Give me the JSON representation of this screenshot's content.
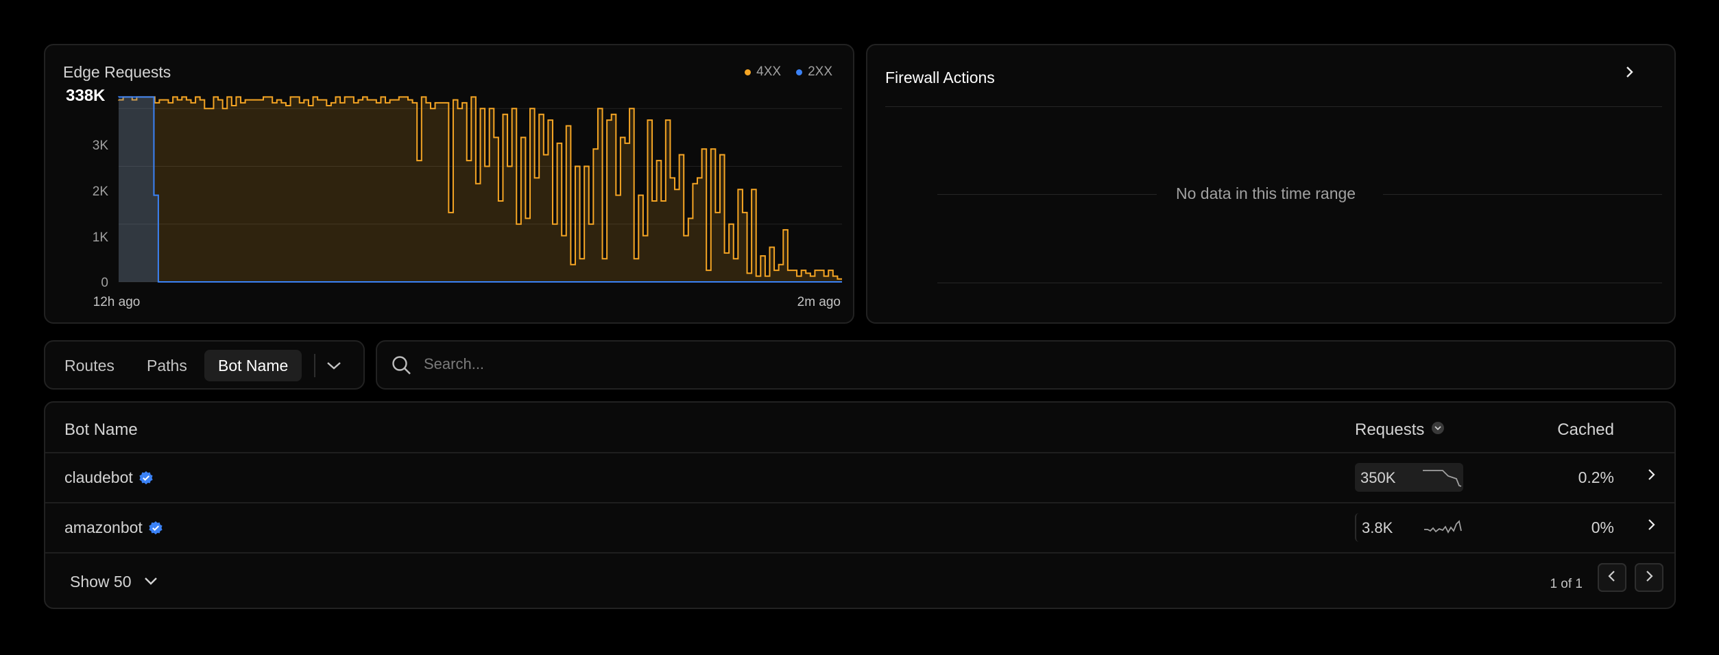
{
  "edge_requests": {
    "title": "Edge Requests",
    "total": "338K",
    "legend": [
      {
        "label": "4XX",
        "color": "#f5a524"
      },
      {
        "label": "2XX",
        "color": "#3b82f6"
      }
    ],
    "x_start_label": "12h ago",
    "x_end_label": "2m ago",
    "y_ticks": [
      "3K",
      "2K",
      "1K",
      "0"
    ]
  },
  "chart_data": {
    "type": "area",
    "title": "Edge Requests",
    "xlabel": "",
    "ylabel": "",
    "ylim": [
      0,
      3300
    ],
    "x_range_labels": [
      "12h ago",
      "2m ago"
    ],
    "y_ticks": [
      0,
      1000,
      2000,
      3000
    ],
    "grid": true,
    "legend_position": "top-right",
    "series": [
      {
        "name": "4XX",
        "color": "#f5a524",
        "values": [
          3150,
          3200,
          3200,
          3150,
          3200,
          3200,
          3200,
          3200,
          3100,
          3150,
          3150,
          3100,
          3200,
          3150,
          3200,
          3150,
          3100,
          3200,
          3150,
          3000,
          3000,
          3200,
          3150,
          3000,
          3200,
          3050,
          3200,
          3100,
          3150,
          3150,
          3150,
          3150,
          3200,
          3200,
          3100,
          3150,
          3100,
          3050,
          3200,
          3200,
          3100,
          3150,
          3050,
          3200,
          3150,
          3150,
          3050,
          3100,
          3200,
          3100,
          3200,
          3200,
          3100,
          3150,
          3200,
          3150,
          3150,
          3100,
          3200,
          3100,
          3150,
          3150,
          3200,
          3200,
          3150,
          3100,
          2100,
          3200,
          3100,
          3000,
          3100,
          3100,
          3100,
          1200,
          3150,
          3000,
          3100,
          2100,
          3200,
          1700,
          3000,
          2000,
          3000,
          2500,
          1400,
          2900,
          2000,
          3000,
          1000,
          2500,
          1100,
          3000,
          1800,
          2900,
          2200,
          2800,
          1000,
          2400,
          800,
          2700,
          300,
          2000,
          400,
          2000,
          1000,
          2300,
          3000,
          400,
          2800,
          2900,
          1500,
          2500,
          2400,
          3000,
          400,
          1500,
          800,
          2800,
          1400,
          2100,
          1400,
          2800,
          1800,
          1600,
          2200,
          800,
          1100,
          1700,
          1800,
          2300,
          200,
          2300,
          1200,
          2200,
          500,
          1000,
          400,
          1600,
          1200,
          150,
          1600,
          100,
          450,
          100,
          600,
          200,
          300,
          900,
          200,
          200,
          100,
          200,
          150,
          100,
          200,
          200,
          100,
          200,
          100,
          50
        ]
      },
      {
        "name": "2XX",
        "color": "#3b82f6",
        "values": [
          3200,
          3200,
          3200,
          3200,
          3200,
          3200,
          3200,
          3200,
          1500,
          0,
          0,
          0,
          0,
          0,
          0,
          0,
          0,
          0,
          0,
          0,
          0,
          0,
          0,
          0,
          0,
          0,
          0,
          0,
          0,
          0,
          0,
          0,
          0,
          0,
          0,
          0,
          0,
          0,
          0,
          0,
          0,
          0,
          0,
          0,
          0,
          0,
          0,
          0,
          0,
          0,
          0,
          0,
          0,
          0,
          0,
          0,
          0,
          0,
          0,
          0,
          0,
          0,
          0,
          0,
          0,
          0,
          0,
          0,
          0,
          0,
          0,
          0,
          0,
          0,
          0,
          0,
          0,
          0,
          0,
          0,
          0,
          0,
          0,
          0,
          0,
          0,
          0,
          0,
          0,
          0,
          0,
          0,
          0,
          0,
          0,
          0,
          0,
          0,
          0,
          0,
          0,
          0,
          0,
          0,
          0,
          0,
          0,
          0,
          0,
          0,
          0,
          0,
          0,
          0,
          0,
          0,
          0,
          0,
          0,
          0,
          0,
          0,
          0,
          0,
          0,
          0,
          0,
          0,
          0,
          0,
          0,
          0,
          0,
          0,
          0,
          0,
          0,
          0,
          0,
          0,
          0,
          0,
          0,
          0,
          0,
          0,
          0,
          0,
          0,
          0,
          0,
          0,
          0,
          0,
          0,
          0,
          0,
          0,
          0,
          0,
          0,
          0,
          0,
          0
        ]
      }
    ]
  },
  "firewall_actions": {
    "title": "Firewall Actions",
    "empty_text": "No data in this time range"
  },
  "tabs": {
    "items": [
      "Routes",
      "Paths",
      "Bot Name"
    ],
    "active": "Bot Name"
  },
  "search": {
    "placeholder": "Search..."
  },
  "table": {
    "columns": {
      "name": "Bot Name",
      "requests": "Requests",
      "cached": "Cached"
    },
    "rows": [
      {
        "name": "claudebot",
        "requests": "350K",
        "cached": "0.2%"
      },
      {
        "name": "amazonbot",
        "requests": "3.8K",
        "cached": "0%"
      }
    ],
    "show_label": "Show 50",
    "pagination": "1 of 1"
  },
  "colors": {
    "accent_4xx": "#f5a524",
    "accent_2xx": "#3b82f6",
    "verified_badge": "#3b82f6"
  }
}
